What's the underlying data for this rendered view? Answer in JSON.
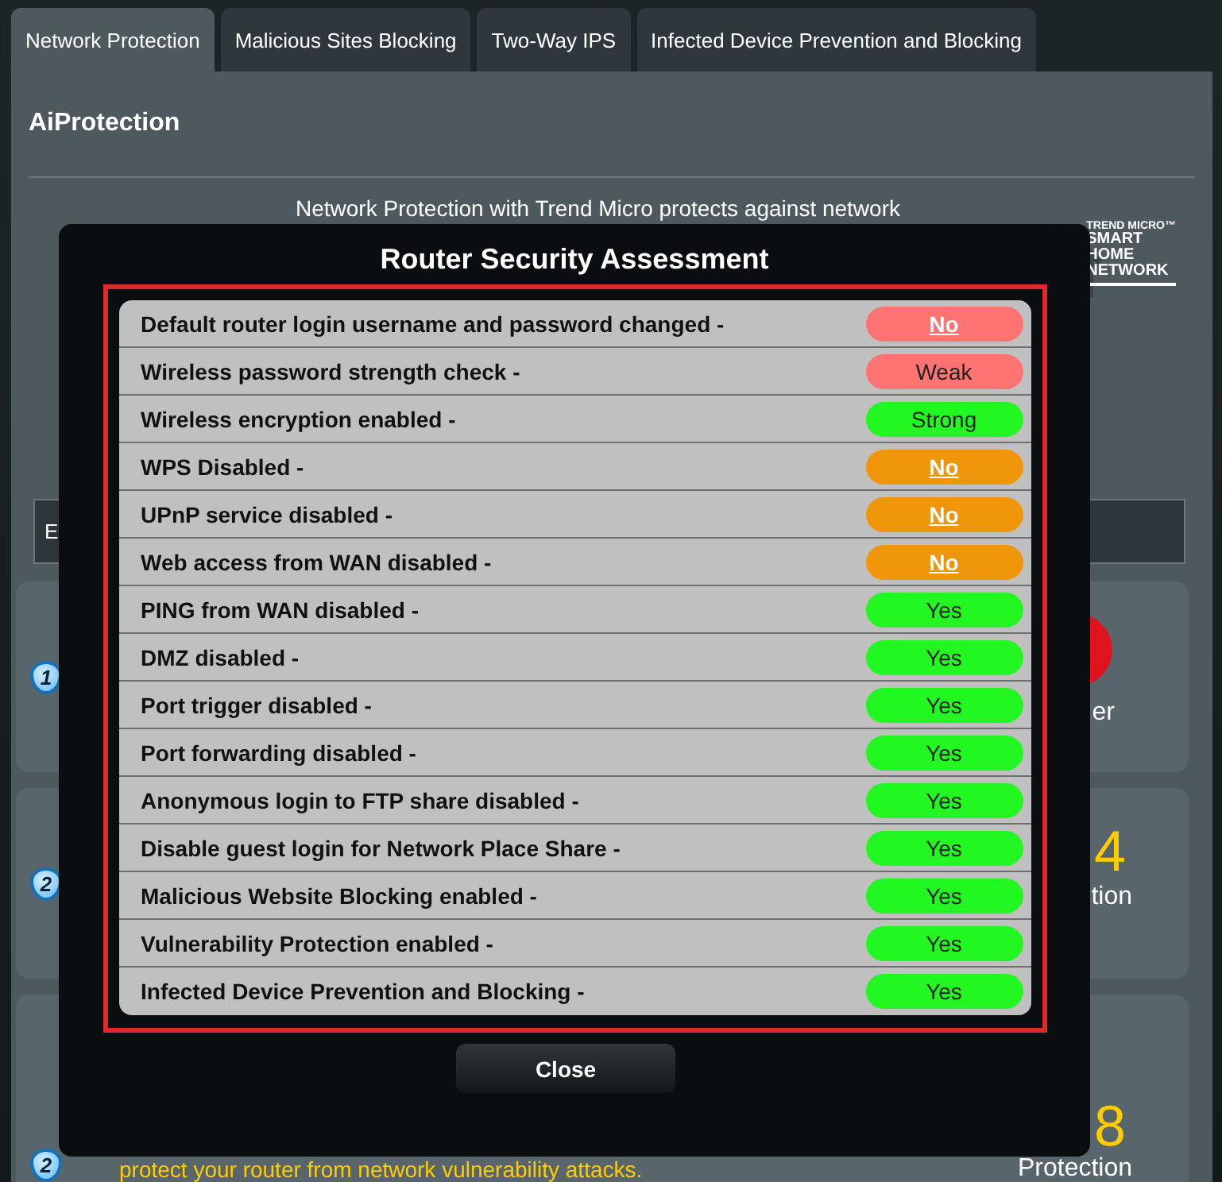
{
  "tabs": [
    {
      "label": "Network Protection",
      "selected": true
    },
    {
      "label": "Malicious Sites Blocking",
      "selected": false
    },
    {
      "label": "Two-Way IPS",
      "selected": false
    },
    {
      "label": "Infected Device Prevention and Blocking",
      "selected": false
    }
  ],
  "panel": {
    "title": "AiProtection",
    "intro": {
      "line_1": "Network Protection with Trend Micro protects against network"
    },
    "logo": {
      "brand": "TREND MICRO™",
      "lines": [
        "SMART",
        "HOME",
        "NETWORK"
      ]
    },
    "enable_bar": {
      "label": "E"
    },
    "cards": [
      {
        "kind": "danger",
        "step": "1",
        "stat_label": "er"
      },
      {
        "kind": "count",
        "step": "2",
        "stat_value": "4",
        "stat_label": "tion"
      },
      {
        "kind": "count",
        "step": "2",
        "description": [
          "protect your router from network vulnerability attacks."
        ],
        "stat_value": "8",
        "stat_label": "Protection"
      }
    ]
  },
  "modal": {
    "title": "Router Security Assessment",
    "items": [
      {
        "label": "Default router login username and password changed -",
        "value": "No",
        "color": "#ff7373",
        "kind": "link"
      },
      {
        "label": "Wireless password strength check -",
        "value": "Weak",
        "color": "#ff7373",
        "kind": "text"
      },
      {
        "label": "Wireless encryption enabled -",
        "value": "Strong",
        "color": "#22f722",
        "kind": "text"
      },
      {
        "label": "WPS Disabled -",
        "value": "No",
        "color": "#f0960a",
        "kind": "link"
      },
      {
        "label": "UPnP service disabled -",
        "value": "No",
        "color": "#f0960a",
        "kind": "link"
      },
      {
        "label": "Web access from WAN disabled -",
        "value": "No",
        "color": "#f0960a",
        "kind": "link"
      },
      {
        "label": "PING from WAN disabled -",
        "value": "Yes",
        "color": "#22f722",
        "kind": "text"
      },
      {
        "label": "DMZ disabled -",
        "value": "Yes",
        "color": "#22f722",
        "kind": "text"
      },
      {
        "label": "Port trigger disabled -",
        "value": "Yes",
        "color": "#22f722",
        "kind": "text"
      },
      {
        "label": "Port forwarding disabled -",
        "value": "Yes",
        "color": "#22f722",
        "kind": "text"
      },
      {
        "label": "Anonymous login to FTP share disabled -",
        "value": "Yes",
        "color": "#22f722",
        "kind": "text"
      },
      {
        "label": "Disable guest login for Network Place Share -",
        "value": "Yes",
        "color": "#22f722",
        "kind": "text"
      },
      {
        "label": "Malicious Website Blocking enabled -",
        "value": "Yes",
        "color": "#22f722",
        "kind": "text"
      },
      {
        "label": "Vulnerability Protection enabled -",
        "value": "Yes",
        "color": "#22f722",
        "kind": "text"
      },
      {
        "label": "Infected Device Prevention and Blocking -",
        "value": "Yes",
        "color": "#22f722",
        "kind": "text"
      }
    ],
    "close_button": "Close"
  }
}
